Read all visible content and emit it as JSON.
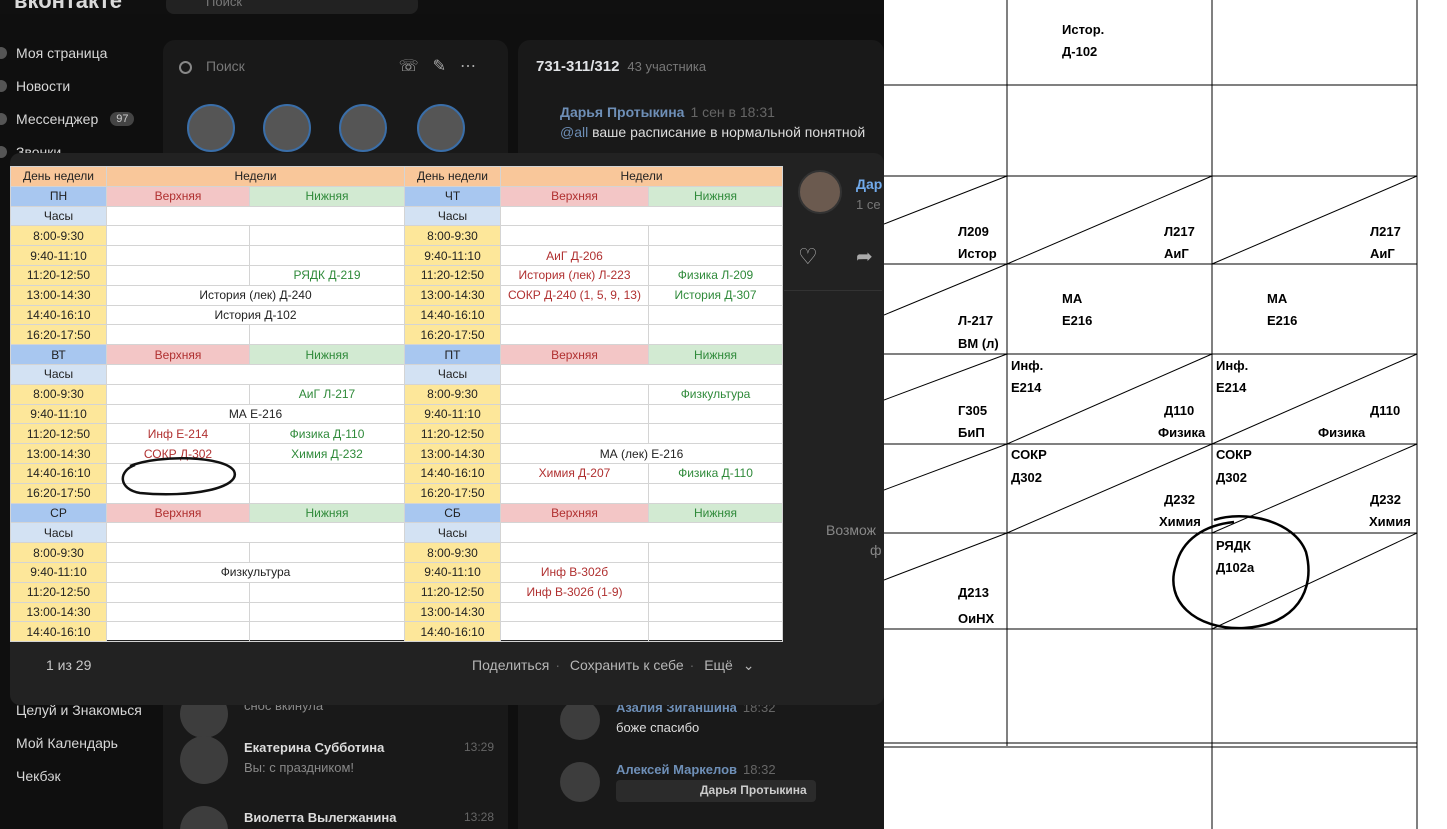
{
  "vk": {
    "logo": "вконтакте",
    "search_placeholder": "Поиск",
    "nav": [
      "Моя страница",
      "Новости",
      "Мессенджер",
      "Звонки"
    ],
    "messenger_badge": "97",
    "nav_bottom": [
      "Целуй и Знакомься",
      "Мой Календарь",
      "Чекбэк"
    ]
  },
  "messenger": {
    "search_placeholder": "Поиск",
    "items": [
      {
        "name": "",
        "text": "снос вкинула",
        "time": ""
      },
      {
        "name": "Екатерина Субботина",
        "text": "Вы: с праздником!",
        "time": "13:29"
      },
      {
        "name": "Виолетта Вылегжанина",
        "text": "",
        "time": "13:28"
      }
    ]
  },
  "chat": {
    "title": "731-311/312",
    "members": "43 участника",
    "pinned_author": "Дарья Протыкина",
    "pinned_time": "1 сен в 18:31",
    "pinned_at": "@all",
    "pinned_text": " ваше расписание в нормальной понятной",
    "msgs": [
      {
        "name": "Азалия Зиганшина",
        "time": "18:32",
        "text": "боже спасибо"
      },
      {
        "name": "Алексей Маркелов",
        "time": "18:32",
        "quote": "Дарья Протыкина"
      }
    ]
  },
  "viewer": {
    "counter": "1 из 29",
    "share": "Поделиться",
    "save": "Сохранить к себе",
    "more": "Ещё",
    "author_short": "Дар",
    "date_short": "1 се",
    "possible": "Возмож",
    "possible2": "ф"
  },
  "schedule": {
    "h_day": "День недели",
    "h_weeks": "Недели",
    "upper": "Верхняя",
    "lower": "Нижняя",
    "hours": "Часы",
    "blocks": [
      {
        "left": {
          "day": "ПН",
          "times": [
            "8:00-9:30",
            "9:40-11:10",
            "11:20-12:50",
            "13:00-14:30",
            "14:40-16:10",
            "16:20-17:50"
          ],
          "rows": [
            [
              "",
              ""
            ],
            [
              "",
              ""
            ],
            [
              "",
              "РЯДК Д-219"
            ],
            [
              "История (лек) Д-240",
              ""
            ],
            [
              "История Д-102",
              ""
            ],
            [
              "",
              ""
            ]
          ],
          "span": [
            false,
            false,
            false,
            true,
            true,
            false
          ]
        },
        "right": {
          "day": "ЧТ",
          "times": [
            "8:00-9:30",
            "9:40-11:10",
            "11:20-12:50",
            "13:00-14:30",
            "14:40-16:10",
            "16:20-17:50"
          ],
          "rows": [
            [
              "",
              ""
            ],
            [
              "АиГ Д-206",
              ""
            ],
            [
              "История (лек) Л-223",
              "Физика Л-209"
            ],
            [
              "СОКР Д-240 (1, 5, 9, 13)",
              "История Д-307"
            ],
            [
              "",
              ""
            ],
            [
              "",
              ""
            ]
          ],
          "span": [
            false,
            false,
            false,
            false,
            false,
            false
          ]
        }
      },
      {
        "left": {
          "day": "ВТ",
          "times": [
            "8:00-9:30",
            "9:40-11:10",
            "11:20-12:50",
            "13:00-14:30",
            "14:40-16:10",
            "16:20-17:50"
          ],
          "rows": [
            [
              "",
              "АиГ Л-217"
            ],
            [
              "МА Е-216",
              ""
            ],
            [
              "Инф Е-214",
              "Физика Д-110"
            ],
            [
              "СОКР Д-302",
              "Химия Д-232"
            ],
            [
              "",
              ""
            ],
            [
              "",
              ""
            ]
          ],
          "span": [
            false,
            true,
            false,
            false,
            false,
            false
          ]
        },
        "right": {
          "day": "ПТ",
          "times": [
            "8:00-9:30",
            "9:40-11:10",
            "11:20-12:50",
            "13:00-14:30",
            "14:40-16:10",
            "16:20-17:50"
          ],
          "rows": [
            [
              "",
              "Физкультура"
            ],
            [
              "",
              ""
            ],
            [
              "",
              ""
            ],
            [
              "МА (лек) Е-216",
              ""
            ],
            [
              "Химия Д-207",
              "Физика Д-110"
            ],
            [
              "",
              ""
            ]
          ],
          "span": [
            false,
            false,
            false,
            true,
            false,
            false
          ]
        }
      },
      {
        "left": {
          "day": "СР",
          "times": [
            "8:00-9:30",
            "9:40-11:10",
            "11:20-12:50",
            "13:00-14:30",
            "14:40-16:10"
          ],
          "rows": [
            [
              "",
              ""
            ],
            [
              "Физкультура",
              ""
            ],
            [
              "",
              ""
            ],
            [
              "",
              ""
            ],
            [
              "",
              ""
            ]
          ],
          "span": [
            false,
            true,
            false,
            false,
            false
          ]
        },
        "right": {
          "day": "СБ",
          "times": [
            "8:00-9:30",
            "9:40-11:10",
            "11:20-12:50",
            "13:00-14:30",
            "14:40-16:10"
          ],
          "rows": [
            [
              "",
              ""
            ],
            [
              "Инф В-302б",
              ""
            ],
            [
              "Инф В-302б (1-9)",
              ""
            ],
            [
              "",
              ""
            ],
            [
              "",
              ""
            ]
          ],
          "span": [
            false,
            false,
            false,
            false,
            false
          ]
        }
      }
    ]
  },
  "paper": {
    "top": [
      "Истор.",
      "Д-102"
    ],
    "r3c1": [
      "Л209",
      "Истор"
    ],
    "r3c2": [
      "Л217",
      "АиГ"
    ],
    "r3c3": [
      "Л217",
      "АиГ"
    ],
    "r4c1": [
      "Л-217",
      "ВМ (л)"
    ],
    "r4c2": [
      "МА",
      "Е216"
    ],
    "r4c3": [
      "МА",
      "Е216"
    ],
    "r5c1": [
      "Г305",
      "БиП"
    ],
    "r5c2a": [
      "Инф.",
      "Е214"
    ],
    "r5c2b": [
      "Д110",
      "Физика"
    ],
    "r5c3a": [
      "Инф.",
      "Е214"
    ],
    "r5c3b": [
      "Д110",
      "Физика"
    ],
    "r6c2a": [
      "СОКР",
      "Д302"
    ],
    "r6c2b": [
      "Д232",
      "Химия"
    ],
    "r6c3a": [
      "СОКР",
      "Д302"
    ],
    "r6c3b": [
      "Д232",
      "Химия"
    ],
    "r7c1": [
      "Д213",
      "ОиНХ"
    ],
    "r7c3": [
      "РЯДК",
      "Д102а"
    ]
  }
}
